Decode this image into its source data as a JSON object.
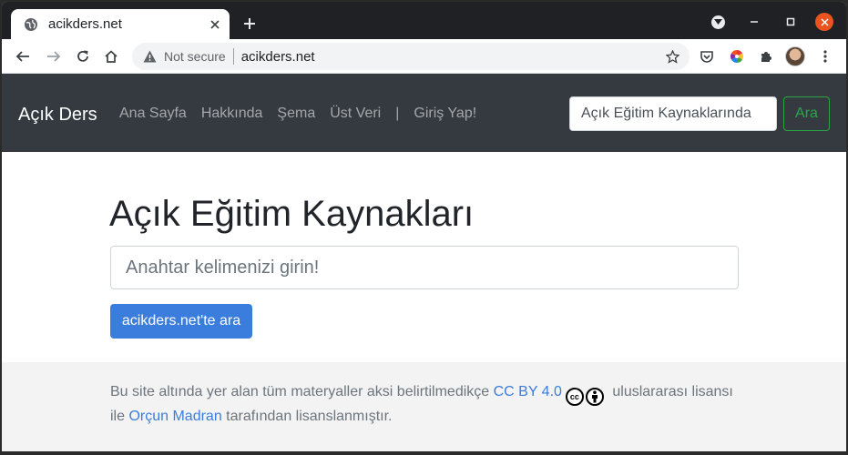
{
  "browser": {
    "tab_title": "acikders.net",
    "security_label": "Not secure",
    "url": "acikders.net",
    "icons": [
      "globe-icon",
      "close-icon",
      "plus-icon",
      "back-icon",
      "forward-icon",
      "reload-icon",
      "home-icon",
      "warning-icon",
      "star-icon",
      "pocket-icon",
      "color-wheel-icon",
      "extensions-icon",
      "avatar",
      "menu-icon",
      "minimize-icon",
      "maximize-icon",
      "close-window-icon"
    ]
  },
  "navbar": {
    "brand": "Açık Ders",
    "links": [
      "Ana Sayfa",
      "Hakkında",
      "Şema",
      "Üst Veri",
      "|",
      "Giriş Yap!"
    ],
    "search_placeholder": "Açık Eğitim Kaynaklarında",
    "search_button": "Ara"
  },
  "hero": {
    "title": "Açık Eğitim Kaynakları",
    "input_placeholder": "Anahtar kelimenizi girin!",
    "button_label": "acikders.net'te ara"
  },
  "footer": {
    "text_1": "Bu site altında yer alan tüm materyaller aksi belirtilmedikçe ",
    "license_link": "CC BY 4.0",
    "text_2": " uluslararası lisansı ile ",
    "author_link": "Orçun Madran",
    "text_3": " tarafından lisanslanmıştır."
  },
  "colors": {
    "navbar_bg": "#343a40",
    "accent_blue": "#3b7ddd",
    "success_green": "#28a745",
    "footer_bg": "#f3f3f3",
    "tabstrip_bg": "#202124"
  }
}
